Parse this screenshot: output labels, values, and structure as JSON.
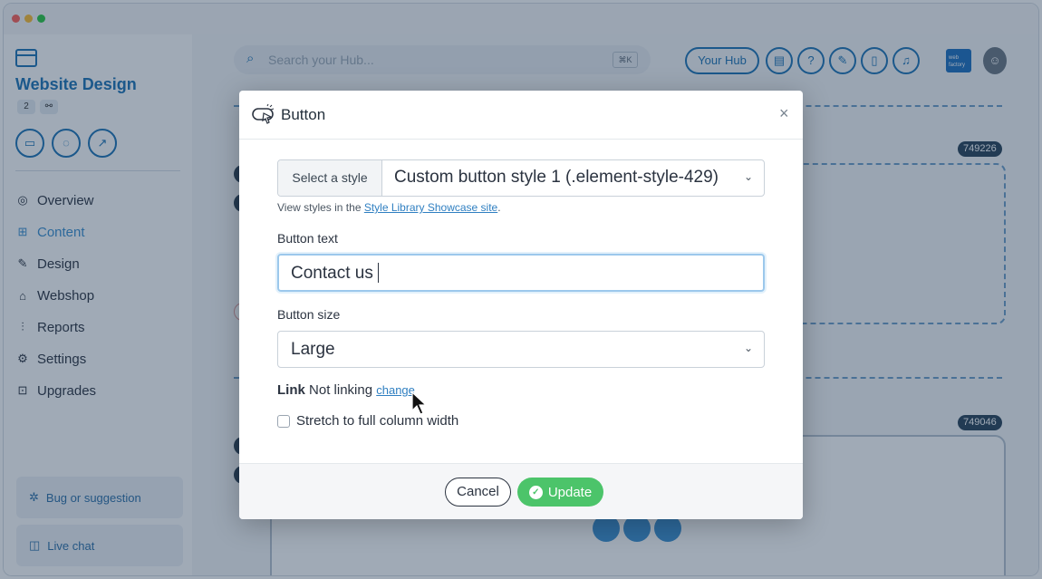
{
  "sidebar": {
    "title": "Website Design",
    "badge_count": "2",
    "nav": [
      {
        "label": "Overview",
        "icon": "overview-icon"
      },
      {
        "label": "Content",
        "icon": "content-icon"
      },
      {
        "label": "Design",
        "icon": "design-icon"
      },
      {
        "label": "Webshop",
        "icon": "webshop-icon"
      },
      {
        "label": "Reports",
        "icon": "reports-icon"
      },
      {
        "label": "Settings",
        "icon": "settings-icon"
      },
      {
        "label": "Upgrades",
        "icon": "upgrades-icon"
      }
    ],
    "bug_label": "Bug or suggestion",
    "chat_label": "Live chat"
  },
  "topbar": {
    "search_placeholder": "Search your Hub...",
    "search_shortcut": "⌘K",
    "your_hub_label": "Your Hub"
  },
  "canvas": {
    "block_id_1": "749226",
    "block_id_2": "749046"
  },
  "modal": {
    "title": "Button",
    "style_prefix": "Select a style",
    "style_value": "Custom button style 1 (.element-style-429)",
    "hint_text": "View styles in the ",
    "hint_link": "Style Library Showcase site",
    "hint_end": ".",
    "button_text_label": "Button text",
    "button_text_value": "Contact us",
    "button_size_label": "Button size",
    "button_size_value": "Large",
    "link_label": "Link",
    "link_status": "Not linking",
    "link_change": "change",
    "stretch_label": "Stretch to full column width",
    "cancel_label": "Cancel",
    "update_label": "Update"
  },
  "colors": {
    "accent": "#1a73b5",
    "update_green": "#4cc46a",
    "overlay": "#1c3452"
  }
}
